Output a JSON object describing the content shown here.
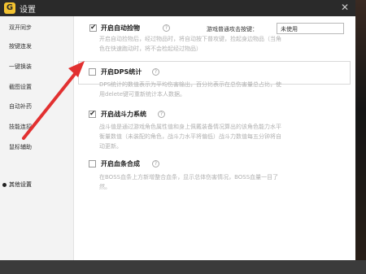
{
  "window": {
    "title": "设置",
    "logo_text": "G",
    "close_glyph": "✕",
    "logo_color": "#f2c230"
  },
  "sidebar": {
    "items": [
      {
        "label": "双开同步"
      },
      {
        "label": "按键连发"
      },
      {
        "label": "一键换装"
      },
      {
        "label": "截图设置"
      },
      {
        "label": "自动补药"
      },
      {
        "label": "技能连招"
      },
      {
        "label": "鼠标辅助"
      },
      {
        "label": "其他设置"
      }
    ],
    "active_index": 7
  },
  "settings": {
    "auto_pickup": {
      "label": "开启自动捡物",
      "checked": true,
      "desc": [
        "开启自动捡物后，经过物品时，将自动按下普攻键，捡起身边物品（当角",
        "色在快速跑动时，将不会检起经过物品）"
      ],
      "hotkey_label": "游戏普通攻击按键：",
      "hotkey_value": "未使用"
    },
    "dps": {
      "label": "开启DPS统计",
      "checked": false,
      "desc": [
        "DPS统计的数值表示为平均伤害输出，百分比表示在总伤害量总占比，使",
        "用delete键可重新统计本人数据。"
      ]
    },
    "power": {
      "label": "开启战斗力系统",
      "checked": true,
      "desc": [
        "战斗值是通过游戏角色属性值和身上佩戴装备情况算出的该角色能力水平",
        "衡量数值（未装配的角色，战斗力水平将偏低）战斗力数值每五分钟将自",
        "动更新。"
      ]
    },
    "boss": {
      "label": "开启血条合成",
      "checked": false,
      "desc": [
        "在BOSS血条上方新增整合血条，显示总体伤害情况，BOSS血量一目了",
        "然。"
      ]
    }
  },
  "annotation": {
    "arrow_color": "#e23030"
  },
  "check_glyph": "✔",
  "help_glyph": "?"
}
